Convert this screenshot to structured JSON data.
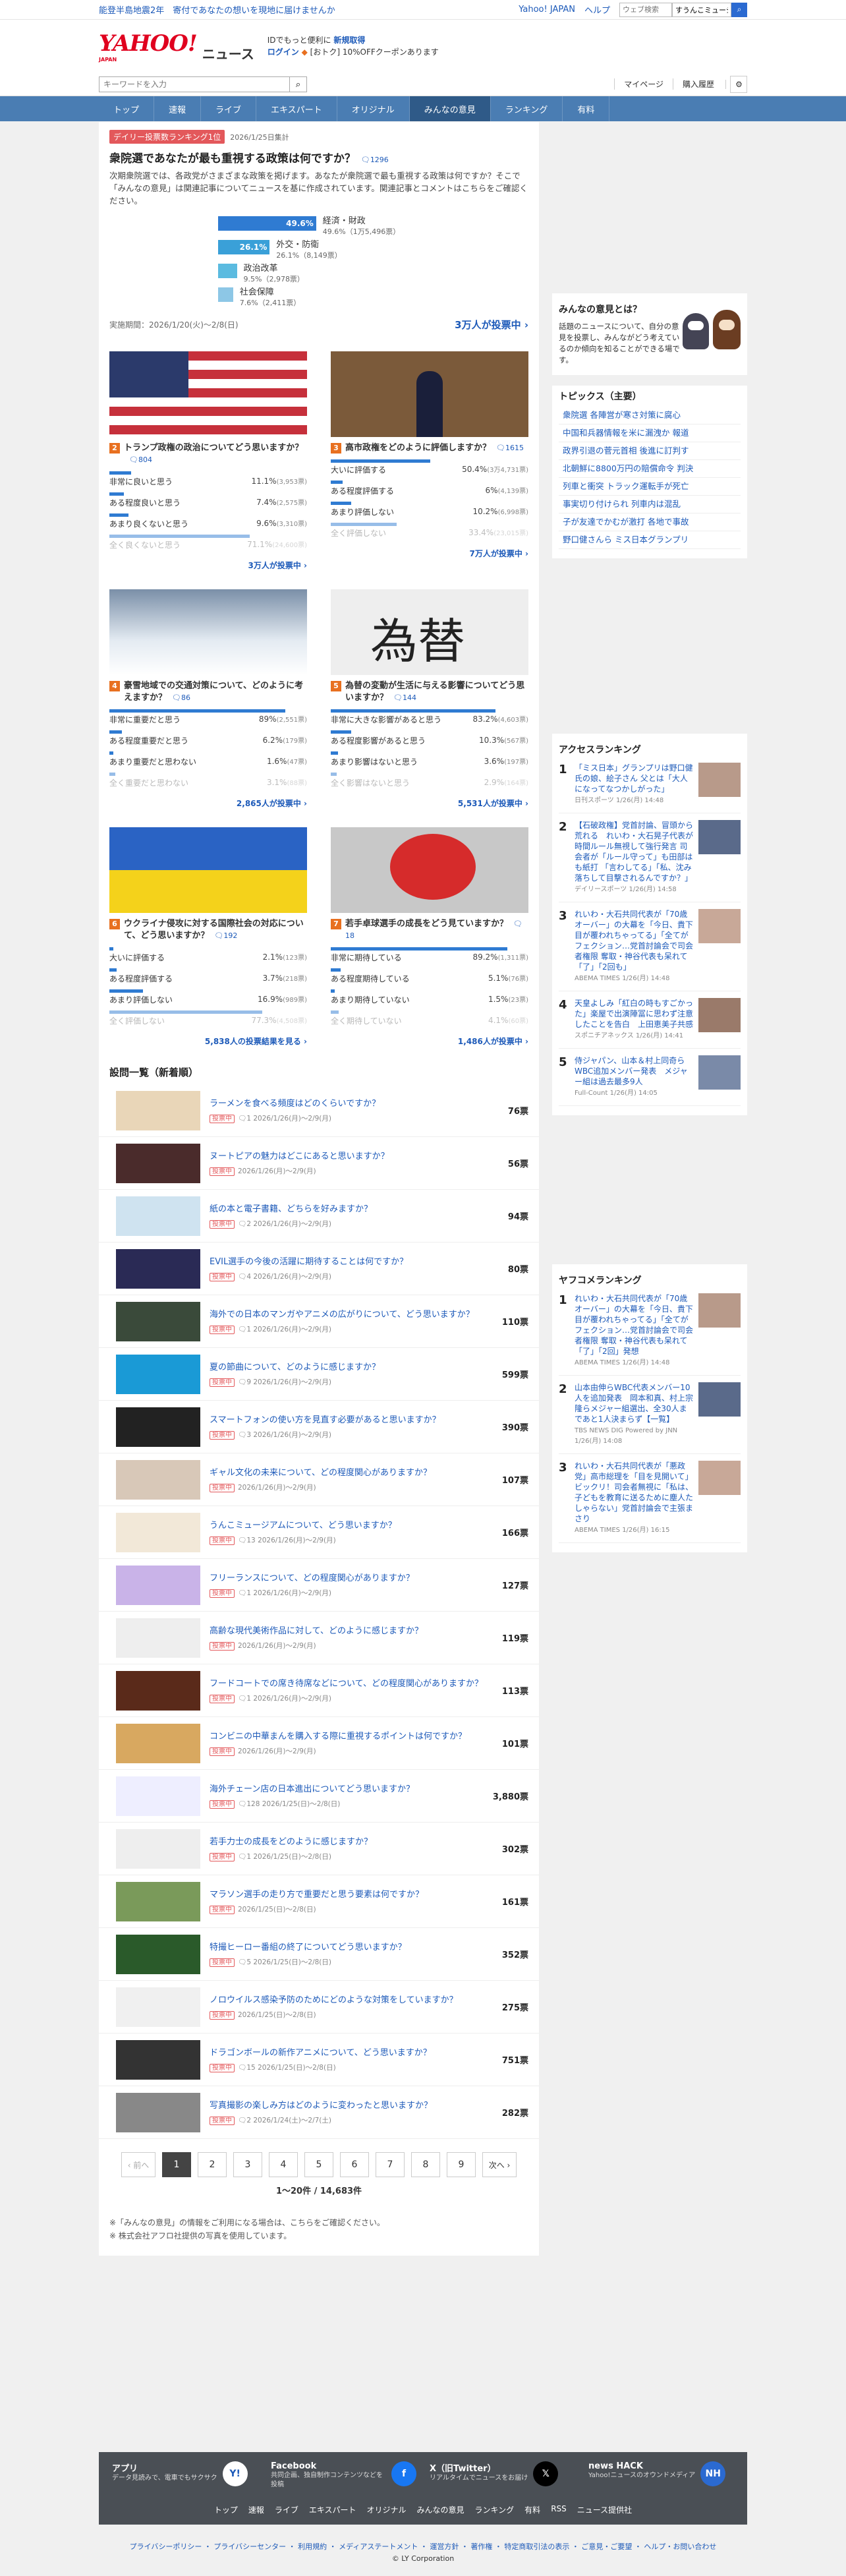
{
  "topbar": {
    "notice": "能登半島地震2年　寄付であなたの想いを現地に届けませんか",
    "links": [
      "Yahoo! JAPAN",
      "ヘルプ"
    ],
    "search_placeholder": "ウェブ検索",
    "search_value": "すうんこミュージアム"
  },
  "header": {
    "logo": "YAHOO!",
    "logo_sub": "JAPAN",
    "section": "ニュース",
    "promo1": "IDでもっと便利に",
    "promo1_link": "新規取得",
    "promo2_link": "ログイン",
    "promo2": "[おトク] 10%OFFクーポンあります"
  },
  "search": {
    "placeholder": "キーワードを入力",
    "mypage": "マイページ",
    "history": "購入履歴"
  },
  "nav": [
    "トップ",
    "速報",
    "ライブ",
    "エキスパート",
    "オリジナル",
    "みんなの意見",
    "ランキング",
    "有料"
  ],
  "feature": {
    "tag": "デイリー投票数ランキング1位",
    "date": "2026/1/25日集計",
    "title": "衆院選であなたが最も重視する政策は何ですか？",
    "comments": "1296",
    "desc": "次期衆院選では、各政党がさまざまな政策を掲げます。あなたが衆院選で最も重視する政策は何ですか？そこで「みんなの意見」は関連記事についてニュースを基に作成されています。関連記事とコメントはこちらをご確認ください。",
    "options": [
      {
        "label": "経済・財政",
        "pct": "49.6%",
        "detail": "49.6%（1万5,496票）",
        "value": 49.6
      },
      {
        "label": "外交・防衛",
        "pct": "26.1%",
        "detail": "26.1%（8,149票）",
        "value": 26.1
      },
      {
        "label": "政治改革",
        "pct": "",
        "detail": "9.5%（2,978票）",
        "value": 9.5
      },
      {
        "label": "社会保障",
        "pct": "",
        "detail": "7.6%（2,411票）",
        "value": 7.6
      }
    ],
    "period": "実施期間：2026/1/20(火)〜2/8(日)",
    "count": "3万人が投票中 ›"
  },
  "cards": [
    {
      "n": "2",
      "title": "トランプ政権の政治についてどう思いますか？",
      "cc": "804",
      "opts": [
        [
          "非常に良いと思う",
          "11.1%",
          "(3,953票)",
          11.1
        ],
        [
          "ある程度良いと思う",
          "7.4%",
          "(2,575票)",
          7.4
        ],
        [
          "あまり良くないと思う",
          "9.6%",
          "(3,310票)",
          9.6
        ],
        [
          "全く良くないと思う",
          "71.1%",
          "(24,600票)",
          71.1
        ]
      ],
      "count": "3万人が投票中 ›",
      "img": "flag"
    },
    {
      "n": "3",
      "title": "高市政権をどのように評価しますか？",
      "cc": "1615",
      "opts": [
        [
          "大いに評価する",
          "50.4%",
          "(3万4,731票)",
          50.4
        ],
        [
          "ある程度評価する",
          "6%",
          "(4,139票)",
          6
        ],
        [
          "あまり評価しない",
          "10.2%",
          "(6,998票)",
          10.2
        ],
        [
          "全く評価しない",
          "33.4%",
          "(23,015票)",
          33.4
        ]
      ],
      "count": "7万人が投票中 ›",
      "img": "pm"
    },
    {
      "n": "4",
      "title": "豪雪地域での交通対策について、どのように考えますか？",
      "cc": "86",
      "opts": [
        [
          "非常に重要だと思う",
          "89%",
          "(2,551票)",
          89
        ],
        [
          "ある程度重要だと思う",
          "6.2%",
          "(179票)",
          6.2
        ],
        [
          "あまり重要だと思わない",
          "1.6%",
          "(47票)",
          1.6
        ],
        [
          "全く重要だと思わない",
          "3.1%",
          "(88票)",
          3.1
        ]
      ],
      "count": "2,865人が投票中 ›",
      "img": "snow"
    },
    {
      "n": "5",
      "title": "為替の変動が生活に与える影響についてどう思いますか？",
      "cc": "144",
      "opts": [
        [
          "非常に大きな影響があると思う",
          "83.2%",
          "(4,603票)",
          83.2
        ],
        [
          "ある程度影響があると思う",
          "10.3%",
          "(567票)",
          10.3
        ],
        [
          "あまり影響はないと思う",
          "3.6%",
          "(197票)",
          3.6
        ],
        [
          "全く影響はないと思う",
          "2.9%",
          "(164票)",
          2.9
        ]
      ],
      "count": "5,531人が投票中 ›",
      "img": "fx"
    },
    {
      "n": "6",
      "title": "ウクライナ侵攻に対する国際社会の対応について、どう思いますか？",
      "cc": "192",
      "opts": [
        [
          "大いに評価する",
          "2.1%",
          "(123票)",
          2.1
        ],
        [
          "ある程度評価する",
          "3.7%",
          "(218票)",
          3.7
        ],
        [
          "あまり評価しない",
          "16.9%",
          "(989票)",
          16.9
        ],
        [
          "全く評価しない",
          "77.3%",
          "(4,508票)",
          77.3
        ]
      ],
      "count": "5,838人の投票結果を見る ›",
      "img": "ua"
    },
    {
      "n": "7",
      "title": "若手卓球選手の成長をどう見ていますか？",
      "cc": "18",
      "opts": [
        [
          "非常に期待している",
          "89.2%",
          "(1,311票)",
          89.2
        ],
        [
          "ある程度期待している",
          "5.1%",
          "(76票)",
          5.1
        ],
        [
          "あまり期待していない",
          "1.5%",
          "(23票)",
          1.5
        ],
        [
          "全く期待していない",
          "4.1%",
          "(60票)",
          4.1
        ]
      ],
      "count": "1,486人が投票中 ›",
      "img": "tt"
    }
  ],
  "list_title": "設問一覧（新着順）",
  "list": [
    [
      "ラーメンを食べる頻度はどのくらいですか？",
      "2026/1/26(月)〜2/9(月)",
      "1",
      "76票"
    ],
    [
      "ヌートピアの魅力はどこにあると思いますか？",
      "2026/1/26(月)〜2/9(月)",
      "",
      "56票"
    ],
    [
      "紙の本と電子書籍、どちらを好みますか？",
      "2026/1/26(月)〜2/9(月)",
      "2",
      "94票"
    ],
    [
      "EVIL選手の今後の活躍に期待することは何ですか？",
      "2026/1/26(月)〜2/9(月)",
      "4",
      "80票"
    ],
    [
      "海外での日本のマンガやアニメの広がりについて、どう思いますか？",
      "2026/1/26(月)〜2/9(月)",
      "1",
      "110票"
    ],
    [
      "夏の節曲について、どのように感じますか？",
      "2026/1/26(月)〜2/9(月)",
      "9",
      "599票"
    ],
    [
      "スマートフォンの使い方を見直す必要があると思いますか？",
      "2026/1/26(月)〜2/9(月)",
      "3",
      "390票"
    ],
    [
      "ギャル文化の未来について、どの程度関心がありますか？",
      "2026/1/26(月)〜2/9(月)",
      "",
      "107票"
    ],
    [
      "うんこミュージアムについて、どう思いますか？",
      "2026/1/26(月)〜2/9(月)",
      "13",
      "166票"
    ],
    [
      "フリーランスについて、どの程度関心がありますか？",
      "2026/1/26(月)〜2/9(月)",
      "1",
      "127票"
    ],
    [
      "高齢な現代美術作品に対して、どのように感じますか？",
      "2026/1/26(月)〜2/9(月)",
      "",
      "119票"
    ],
    [
      "フードコートでの席き待席などについて、どの程度関心がありますか？",
      "2026/1/26(月)〜2/9(月)",
      "1",
      "113票"
    ],
    [
      "コンビニの中華まんを購入する際に重視するポイントは何ですか？",
      "2026/1/26(月)〜2/9(月)",
      "",
      "101票"
    ],
    [
      "海外チェーン店の日本進出についてどう思いますか？",
      "2026/1/25(日)〜2/8(日)",
      "128",
      "3,880票"
    ],
    [
      "若手力士の成長をどのように感じますか？",
      "2026/1/25(日)〜2/8(日)",
      "1",
      "302票"
    ],
    [
      "マラソン選手の走り方で重要だと思う要素は何ですか？",
      "2026/1/25(日)〜2/8(日)",
      "",
      "161票"
    ],
    [
      "特撮ヒーロー番組の終了についてどう思いますか？",
      "2026/1/25(日)〜2/8(日)",
      "5",
      "352票"
    ],
    [
      "ノロウイルス感染予防のためにどのような対策をしていますか？",
      "2026/1/25(日)〜2/8(日)",
      "",
      "275票"
    ],
    [
      "ドラゴンボールの新作アニメについて、どう思いますか？",
      "2026/1/25(日)〜2/8(日)",
      "15",
      "751票"
    ],
    [
      "写真撮影の楽しみ方はどのように変わったと思いますか？",
      "2026/1/24(土)〜2/7(土)",
      "2",
      "282票"
    ]
  ],
  "tag_label": "投票中",
  "pager": {
    "prev": "‹ 前へ",
    "pages": [
      "1",
      "2",
      "3",
      "4",
      "5",
      "6",
      "7",
      "8",
      "9"
    ],
    "next": "次へ ›",
    "info": "1〜20件 / 14,683件"
  },
  "notes": [
    "※「みんなの意見」の情報をご利用になる場合は、こちらをご確認ください。",
    "※ 株式会社アフロ社提供の写真を使用しています。"
  ],
  "side": {
    "about_title": "みんなの意見とは？",
    "about_text": "話題のニュースについて、自分の意見を投票し、みんながどう考えているのか傾向を知ることができる場です。",
    "topics_title": "トピックス（主要）",
    "topics": [
      "衆院選 各陣営が寒さ対策に腐心",
      "中国和兵器情報を米に漏洩か 報道",
      "政界引退の菅元首相 後進に訂判す",
      "北朝鮮に8800万円の賠償命令 判決",
      "列車と衝突 トラック運転手が死亡",
      "事実切り付けられ 列車内は混乱",
      "子が友達でかむが激打 各地で事故",
      "野口健さんら ミス日本グランプリ"
    ],
    "access_title": "アクセスランキング",
    "access": [
      [
        "「ミス日本」グランプリは野口健氏の娘、絵子さん 父とは「大人になってなつかしがった」",
        "日刊スポーツ 1/26(月) 14:48"
      ],
      [
        "【石破政権】党首討論、冒頭から荒れる　れいわ・大石晃子代表が時間ルール無視して強行発言 司会者が「ルール守って」も田部はも紙打 「言わしてる」「私、沈み落ちして目撃されるんですか？」",
        "デイリースポーツ 1/26(月) 14:58"
      ],
      [
        "れいわ・大石共同代表が「70歳オーバー」の大幕を「今日、貴下目が覆われちゃってる」「全てがフェクション…党首討論会で司会者権限 奪取・神谷代表も呆れて「了」「2回も」",
        "ABEMA TIMES 1/26(月) 14:48"
      ],
      [
        "天皇よしみ「紅白の時もすごかった」楽屋で出演陣冨に思わず注意したことを告白　上田恵美子共感",
        "スポニチアネックス 1/26(月) 14:41"
      ],
      [
        "侍ジャパン、山本＆村上同奇ら WBC追加メンバー発表　メジャー組は過去最多9人",
        "Full-Count 1/26(月) 14:05"
      ]
    ],
    "yafoko_title": "ヤフコメランキング",
    "yafoko": [
      [
        "れいわ・大石共同代表が「70歳オーバー」の大幕を「今日、貴下目が覆われちゃってる」「全てがフェクション…党首討論会で司会者権限 奪取・神谷代表も呆れて「了」「2回」発想",
        "ABEMA TIMES 1/26(月) 14:48"
      ],
      [
        "山本由伸らWBC代表メンバー10人を追加発表　岡本和真、村上宗隆らメジャー組選出、全30人まであと1人決まらず【一覧】",
        "TBS NEWS DIG Powered by JNN 1/26(月) 14:08"
      ],
      [
        "れいわ・大石共同代表が「悪政党」高市総理を「目を見開いて」ビックリ！司会者無視に「私は、子どもを教育に送るために塵人たしゃらない」党首討論会で主張まさり",
        "ABEMA TIMES 1/26(月) 16:15"
      ]
    ]
  },
  "footer": {
    "apps": [
      [
        "アプリ",
        "データ見読みで、電車でもサクサク"
      ],
      [
        "Facebook",
        "共同企画、独自制作コンテンツなどを投稿"
      ],
      [
        "X（旧Twitter）",
        "リアルタイムでニュースをお届け"
      ],
      [
        "news HACK",
        "Yahoo!ニュースのオウンドメディア"
      ]
    ],
    "nav": [
      "トップ",
      "速報",
      "ライブ",
      "エキスパート",
      "オリジナル",
      "みんなの意見",
      "ランキング",
      "有料",
      "RSS",
      "ニュース提供社"
    ],
    "legal": "プライバシーポリシー ・ プライバシーセンター ・ 利用規約 ・ メディアステートメント ・ 運営方針 ・ 著作権 ・ 特定商取引法の表示 ・ ご意見・ご要望 ・ ヘルプ・お問い合わせ",
    "copyright": "© LY Corporation"
  }
}
